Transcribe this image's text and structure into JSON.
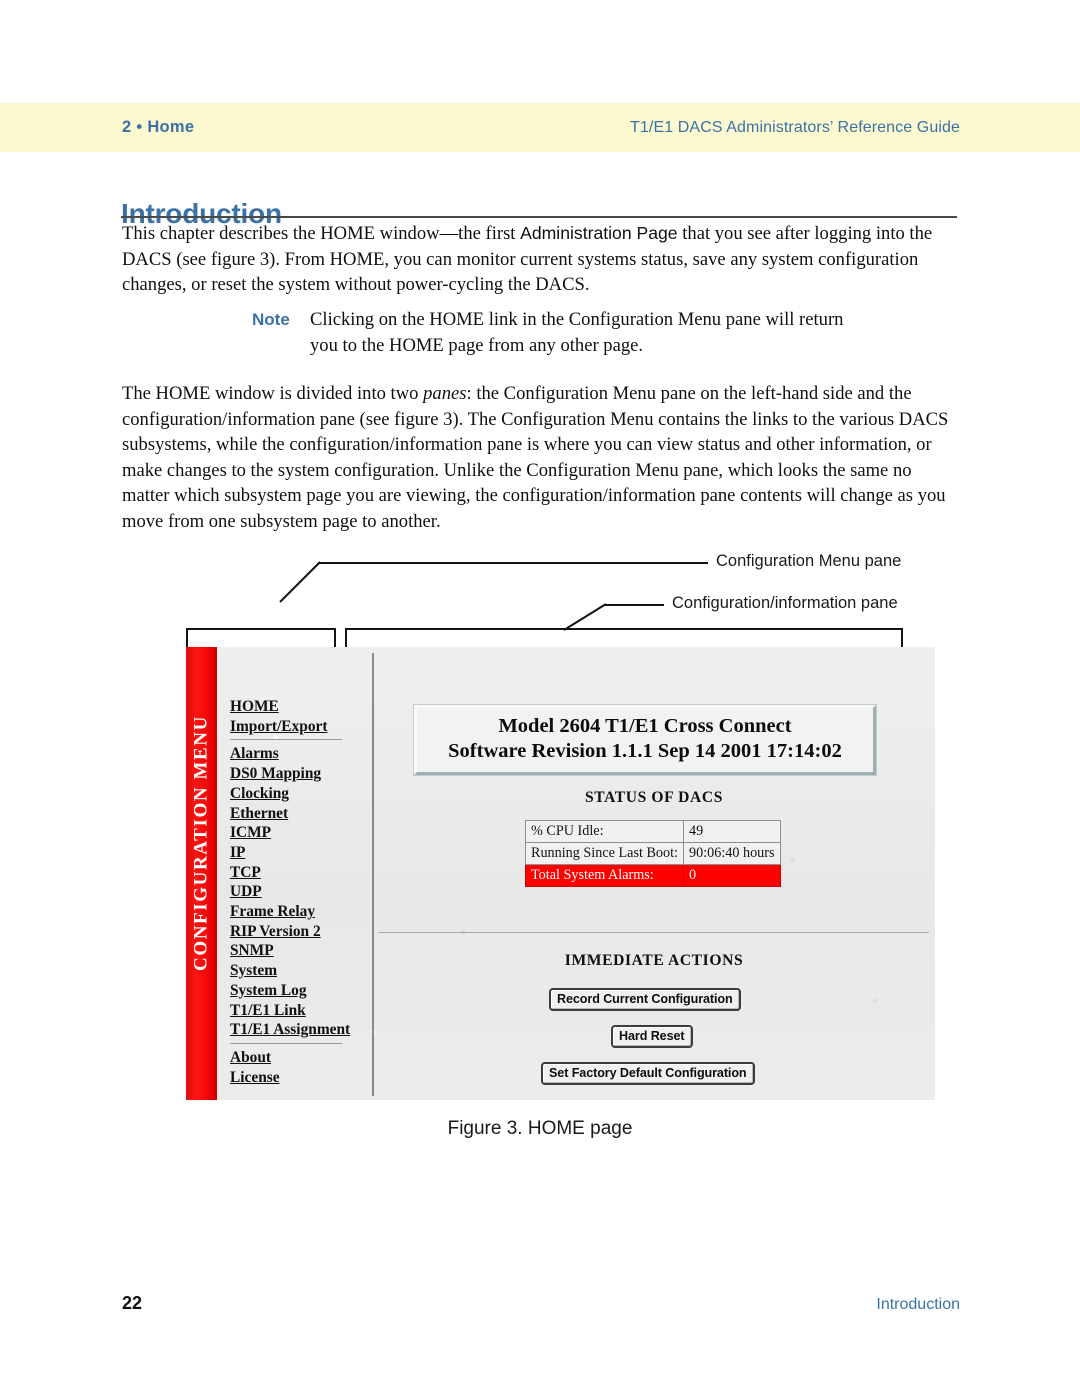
{
  "header": {
    "chapter": "2 • Home",
    "guide_title": "T1/E1 DACS Administrators’ Reference Guide"
  },
  "page_title": "Introduction",
  "paragraphs": {
    "p1_a": "This chapter describes the HOME window—the first ",
    "p1_b": "Administration Page",
    "p1_c": " that you see after logging into the DACS (see figure 3). From HOME, you can monitor current systems status, save any system configuration changes, or reset the system without power-cycling the DACS.",
    "note_label": "Note",
    "note_text": "Clicking on the HOME link in the Configuration Menu pane will return you to the HOME page from any other page.",
    "p2_a": "The HOME window is divided into two ",
    "p2_b": "panes",
    "p2_c": ": the Configuration Menu pane on the left-hand side and the configuration/information pane (see figure 3). The Configuration Menu contains the links to the various DACS subsystems, while the configuration/information pane is where you can view status and other information, or make changes to the system configuration. Unlike the Configuration Menu pane, which looks the same no matter which subsystem page you are viewing, the configuration/information pane contents will change as you move from one subsystem page to another."
  },
  "figure": {
    "callouts": {
      "menu_pane": "Configuration Menu pane",
      "info_pane": "Configuration/information pane"
    },
    "caption": "Figure 3. HOME page",
    "screenshot": {
      "sidebar_title": "CONFIGURATION MENU",
      "menu_group_1": [
        {
          "label": "HOME"
        },
        {
          "label": "Import/Export"
        }
      ],
      "menu_group_2": [
        {
          "label": "Alarms"
        },
        {
          "label": "DS0 Mapping"
        },
        {
          "label": "Clocking"
        },
        {
          "label": "Ethernet"
        },
        {
          "label": "ICMP"
        },
        {
          "label": "IP"
        },
        {
          "label": "TCP"
        },
        {
          "label": "UDP"
        },
        {
          "label": "Frame Relay"
        },
        {
          "label": "RIP Version 2"
        },
        {
          "label": "SNMP"
        },
        {
          "label": "System"
        },
        {
          "label": "System Log"
        },
        {
          "label": "T1/E1 Link"
        },
        {
          "label": "T1/E1 Assignment"
        }
      ],
      "menu_group_3": [
        {
          "label": "About"
        },
        {
          "label": "License"
        }
      ],
      "banner_line_1": "Model 2604 T1/E1 Cross Connect",
      "banner_line_2": "Software Revision 1.1.1 Sep 14 2001 17:14:02",
      "status_heading": "STATUS OF DACS",
      "status_rows": [
        {
          "key": "% CPU Idle:",
          "value": "49",
          "alarm": false
        },
        {
          "key": "Running Since Last Boot:",
          "value": "90:06:40 hours",
          "alarm": false
        },
        {
          "key": "Total System Alarms:",
          "value": "0",
          "alarm": true
        }
      ],
      "actions_heading": "IMMEDIATE ACTIONS",
      "actions": [
        {
          "label": "Record Current Configuration"
        },
        {
          "label": "Hard Reset"
        },
        {
          "label": "Set Factory Default Configuration"
        }
      ],
      "colors": {
        "sidebar_red": "#f20808",
        "alarm_red": "#fd0000"
      }
    }
  },
  "footer": {
    "page_number": "22",
    "section": "Introduction"
  },
  "theme": {
    "header_band": "#fcf8cf",
    "accent_blue": "#3a72a6"
  }
}
